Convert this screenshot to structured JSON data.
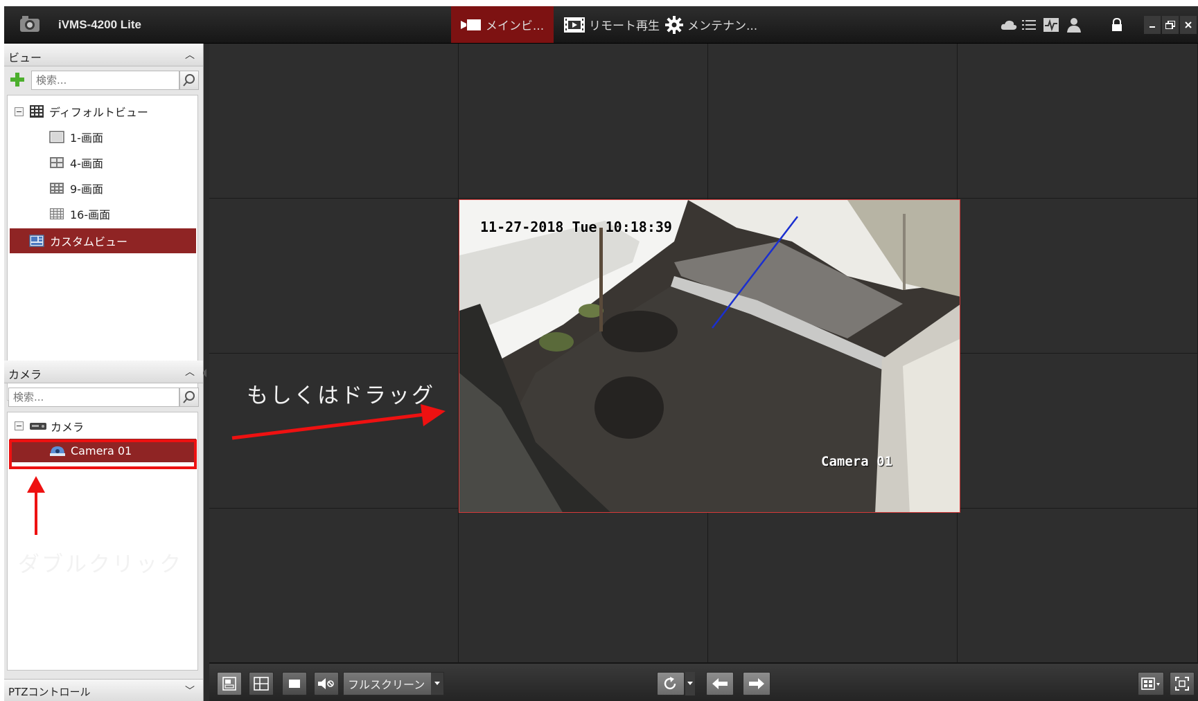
{
  "app": {
    "title": "iVMS-4200 Lite"
  },
  "toptabs": [
    {
      "label": "メインビ..."
    },
    {
      "label": "リモート再生"
    },
    {
      "label": "メンテナン..."
    }
  ],
  "view_panel": {
    "header": "ビュー",
    "search_placeholder": "検索...",
    "tree": {
      "root": "ディフォルトビュー",
      "items": [
        "1-画面",
        "4-画面",
        "9-画面",
        "16-画面"
      ],
      "custom": "カスタムビュー"
    }
  },
  "camera_panel": {
    "header": "カメラ",
    "search_placeholder": "検索...",
    "group": "カメラ",
    "camera": "Camera 01"
  },
  "ptz": {
    "label": "PTZコントロール"
  },
  "live": {
    "osd_time": "11-27-2018 Tue 10:18:39",
    "osd_name": "Camera 01"
  },
  "bottombar": {
    "fullscreen_label": "フルスクリーン"
  },
  "annotations": {
    "drag": "もしくはドラッグ",
    "double_click": "ダブルクリック"
  },
  "colors": {
    "accent": "#7d1212",
    "selection": "#8f2424",
    "annotation": "#ee1111"
  }
}
